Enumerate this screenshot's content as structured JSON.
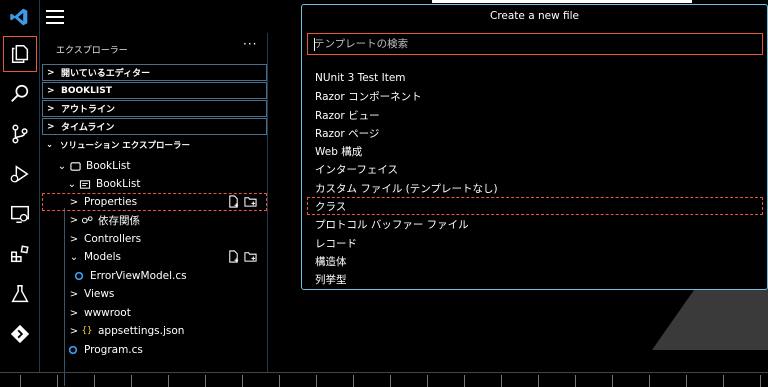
{
  "header": {
    "quickpick_title": "Create a new file",
    "search_placeholder": "テンプレートの検索"
  },
  "sidebar": {
    "title": "エクスプローラー",
    "more": "···",
    "sections": {
      "open_editors": "開いているエディター",
      "booklist": "BOOKLIST",
      "outline": "アウトライン",
      "timeline": "タイムライン",
      "solution_explorer": "ソリューション エクスプローラー"
    },
    "tree": [
      {
        "label": "BookList"
      },
      {
        "label": "BookList"
      },
      {
        "label": "Properties"
      },
      {
        "label": "依存関係"
      },
      {
        "label": "Controllers"
      },
      {
        "label": "Models"
      },
      {
        "label": "ErrorViewModel.cs"
      },
      {
        "label": "Views"
      },
      {
        "label": "wwwroot"
      },
      {
        "label": "appsettings.json"
      },
      {
        "label": "Program.cs"
      }
    ]
  },
  "templates": [
    "NUnit 3 Test Item",
    "Razor コンポーネント",
    "Razor ビュー",
    "Razor ページ",
    "Web 構成",
    "インターフェイス",
    "カスタム ファイル (テンプレートなし)",
    "クラス",
    "プロトコル バッファー ファイル",
    "レコード",
    "構造体",
    "列挙型"
  ],
  "colors": {
    "accent_border": "#e7583a",
    "quickpick_border": "#6fc3df",
    "vscode_blue": "#3c9be8"
  },
  "icons": {
    "activity": [
      "explorer-icon",
      "search-icon",
      "source-control-icon",
      "run-debug-icon",
      "remote-explorer-icon",
      "extensions-icon",
      "testing-icon",
      "git-lens-icon"
    ]
  }
}
